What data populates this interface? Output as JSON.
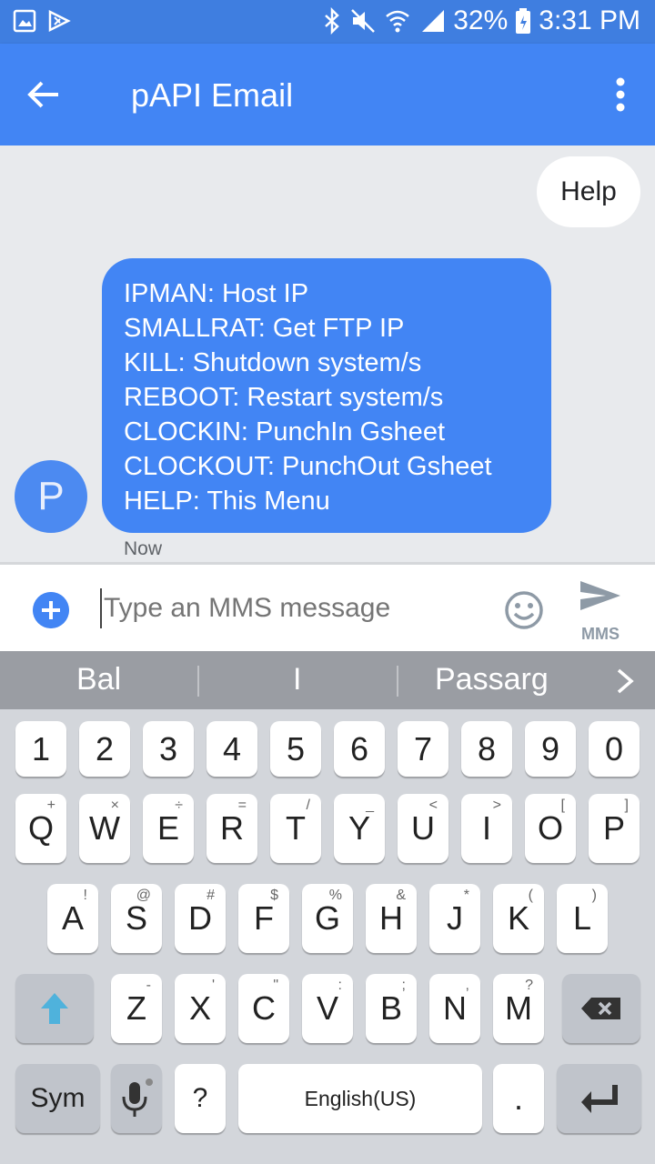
{
  "status": {
    "battery": "32%",
    "time": "3:31 PM"
  },
  "appbar": {
    "title": "pAPI Email"
  },
  "conversation": {
    "outgoing": "Help",
    "incoming_lines": [
      "IPMAN: Host IP",
      "SMALLRAT: Get FTP IP",
      "KILL: Shutdown system/s",
      "REBOOT: Restart system/s",
      "CLOCKIN: PunchIn Gsheet",
      "CLOCKOUT: PunchOut Gsheet",
      "HELP: This Menu"
    ],
    "avatar_letter": "P",
    "timestamp": "Now"
  },
  "compose": {
    "placeholder": "Type an MMS message",
    "send_label": "MMS"
  },
  "suggestions": [
    "Bal",
    "I",
    "Passarg"
  ],
  "keyboard": {
    "numbers": [
      "1",
      "2",
      "3",
      "4",
      "5",
      "6",
      "7",
      "8",
      "9",
      "0"
    ],
    "row1": [
      {
        "k": "Q",
        "s": "+"
      },
      {
        "k": "W",
        "s": "×"
      },
      {
        "k": "E",
        "s": "÷"
      },
      {
        "k": "R",
        "s": "="
      },
      {
        "k": "T",
        "s": "/"
      },
      {
        "k": "Y",
        "s": "_"
      },
      {
        "k": "U",
        "s": "<"
      },
      {
        "k": "I",
        "s": ">"
      },
      {
        "k": "O",
        "s": "["
      },
      {
        "k": "P",
        "s": "]"
      }
    ],
    "row2": [
      {
        "k": "A",
        "s": "!"
      },
      {
        "k": "S",
        "s": "@"
      },
      {
        "k": "D",
        "s": "#"
      },
      {
        "k": "F",
        "s": "$"
      },
      {
        "k": "G",
        "s": "%"
      },
      {
        "k": "H",
        "s": "&"
      },
      {
        "k": "J",
        "s": "*"
      },
      {
        "k": "K",
        "s": "("
      },
      {
        "k": "L",
        "s": ")"
      }
    ],
    "row3": [
      {
        "k": "Z",
        "s": "-"
      },
      {
        "k": "X",
        "s": "'"
      },
      {
        "k": "C",
        "s": "\""
      },
      {
        "k": "V",
        "s": ":"
      },
      {
        "k": "B",
        "s": ";"
      },
      {
        "k": "N",
        "s": ","
      },
      {
        "k": "M",
        "s": "?"
      }
    ],
    "sym": "Sym",
    "question": "?",
    "space": "English(US)",
    "period": "."
  }
}
